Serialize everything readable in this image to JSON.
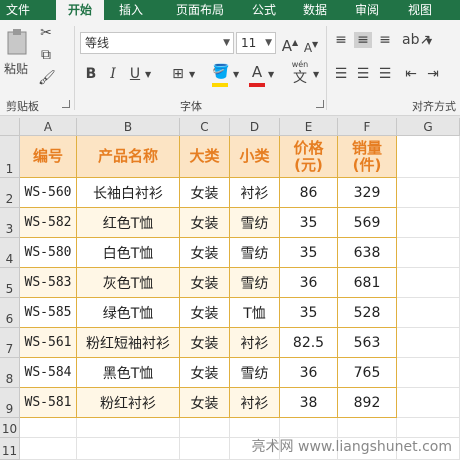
{
  "tabs": [
    "文件",
    "开始",
    "插入",
    "页面布局",
    "公式",
    "数据",
    "审阅",
    "视图"
  ],
  "active_tab": "开始",
  "ribbon": {
    "paste_label": "粘贴",
    "clipboard_label": "剪贴板",
    "font_group_label": "字体",
    "align_group_label": "对齐方式",
    "font_name": "等线",
    "font_size": "11",
    "grow_font": "A",
    "shrink_font": "A",
    "bold": "B",
    "italic": "I",
    "underline": "U",
    "font_color_letter": "A",
    "phonetic_label": "wén",
    "phonetic_char": "文",
    "accent_colors": {
      "fill": "#ffd800",
      "font": "#e02020"
    }
  },
  "columns": [
    "A",
    "B",
    "C",
    "D",
    "E",
    "F",
    "G"
  ],
  "rows": [
    "1",
    "2",
    "3",
    "4",
    "5",
    "6",
    "7",
    "8",
    "9",
    "10",
    "11"
  ],
  "headers": [
    "编号",
    "产品名称",
    "大类",
    "小类",
    "价格\n(元)",
    "销量\n(件)"
  ],
  "data": [
    [
      "WS-560",
      "长袖白衬衫",
      "女装",
      "衬衫",
      "86",
      "329"
    ],
    [
      "WS-582",
      "红色T恤",
      "女装",
      "雪纺",
      "35",
      "569"
    ],
    [
      "WS-580",
      "白色T恤",
      "女装",
      "雪纺",
      "35",
      "638"
    ],
    [
      "WS-583",
      "灰色T恤",
      "女装",
      "雪纺",
      "36",
      "681"
    ],
    [
      "WS-585",
      "绿色T恤",
      "女装",
      "T恤",
      "35",
      "528"
    ],
    [
      "WS-561",
      "粉红短袖衬衫",
      "女装",
      "衬衫",
      "82.5",
      "563"
    ],
    [
      "WS-584",
      "黑色T恤",
      "女装",
      "雪纺",
      "36",
      "765"
    ],
    [
      "WS-581",
      "粉红衬衫",
      "女装",
      "衬衫",
      "38",
      "892"
    ]
  ],
  "watermark": "亮术网 www.liangshunet.com"
}
